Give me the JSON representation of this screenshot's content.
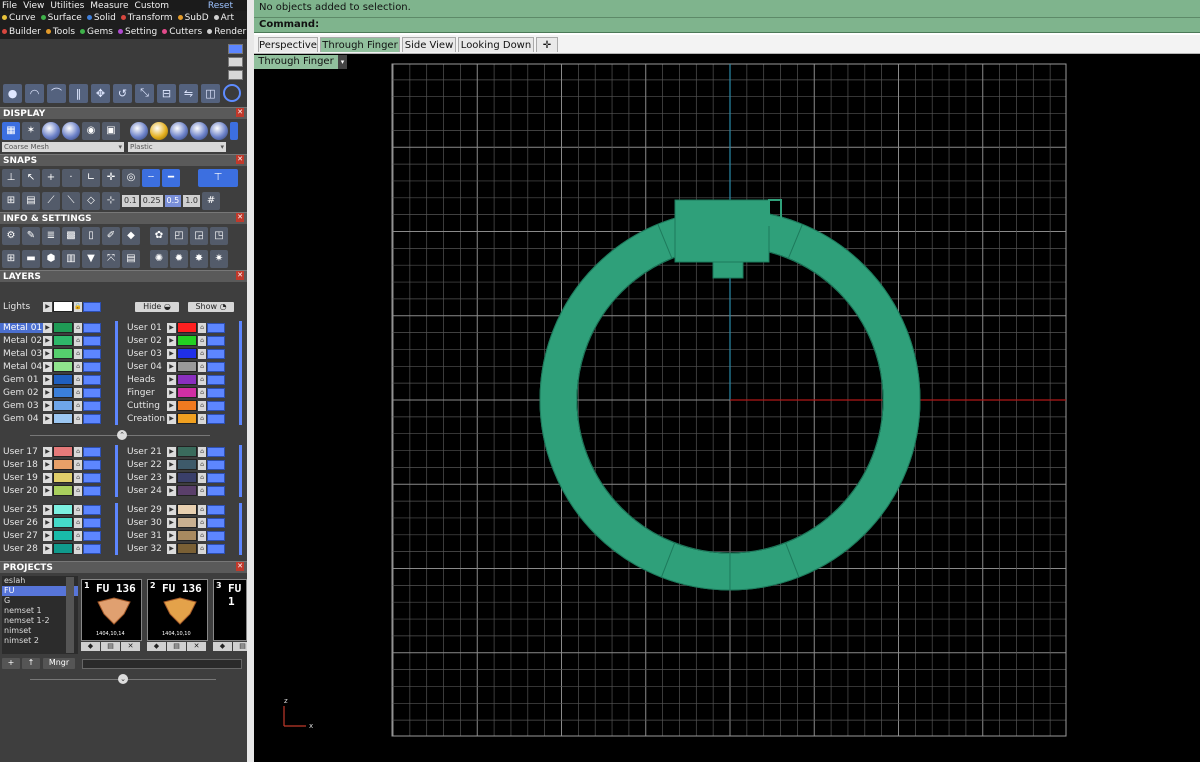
{
  "menubar": {
    "items": [
      "File",
      "View",
      "Utilities",
      "Measure",
      "Custom"
    ],
    "reset": "Reset"
  },
  "tabs1": [
    {
      "label": "Curve",
      "color": "#e8c23a"
    },
    {
      "label": "Surface",
      "color": "#3fb24a"
    },
    {
      "label": "Solid",
      "color": "#3f7ed8"
    },
    {
      "label": "Transform",
      "color": "#d8473f"
    },
    {
      "label": "SubD",
      "color": "#e29a2a"
    },
    {
      "label": "Art",
      "color": "#d0d0d0"
    }
  ],
  "tabs2": [
    {
      "label": "Builder",
      "color": "#d8473f"
    },
    {
      "label": "Tools",
      "color": "#e29a2a"
    },
    {
      "label": "Gems",
      "color": "#3fb24a"
    },
    {
      "label": "Setting",
      "color": "#b04ad0"
    },
    {
      "label": "Cutters",
      "color": "#e24a8a"
    },
    {
      "label": "Render",
      "color": "#d0d0d0"
    }
  ],
  "sections": {
    "display": "DISPLAY",
    "snaps": "SNAPS",
    "info": "INFO & SETTINGS",
    "layers": "LAYERS",
    "projects": "PROJECTS"
  },
  "display": {
    "mesh_select": "Coarse Mesh",
    "material_select": "Plastic"
  },
  "snaps": {
    "values": [
      "0.1",
      "0.25",
      "0.5",
      "1.0"
    ]
  },
  "layers": {
    "lights": "Lights",
    "hide": "Hide",
    "show": "Show",
    "groups_left": [
      [
        {
          "name": "Metal 01",
          "color": "#1f9a55"
        },
        {
          "name": "Metal 02",
          "color": "#2fb86a"
        },
        {
          "name": "Metal 03",
          "color": "#55cf6d"
        },
        {
          "name": "Metal 04",
          "color": "#8fe38d"
        }
      ],
      [
        {
          "name": "Gem 01",
          "color": "#1f5fbf"
        },
        {
          "name": "Gem 02",
          "color": "#3b7fd9"
        },
        {
          "name": "Gem 03",
          "color": "#6ea6ea"
        },
        {
          "name": "Gem 04",
          "color": "#9cc7f2"
        }
      ],
      [
        {
          "name": "User 17",
          "color": "#e57a7a"
        },
        {
          "name": "User 18",
          "color": "#e8a068"
        },
        {
          "name": "User 19",
          "color": "#e1cf6a"
        },
        {
          "name": "User 20",
          "color": "#a9cf5d"
        }
      ],
      [
        {
          "name": "User 25",
          "color": "#7cf0e1"
        },
        {
          "name": "User 26",
          "color": "#45d9c8"
        },
        {
          "name": "User 27",
          "color": "#19bba9"
        },
        {
          "name": "User 28",
          "color": "#109a8c"
        }
      ]
    ],
    "groups_right": [
      [
        {
          "name": "User 01",
          "color": "#ff2020"
        },
        {
          "name": "User 02",
          "color": "#22d022"
        },
        {
          "name": "User 03",
          "color": "#1f2fe8"
        },
        {
          "name": "User 04",
          "color": "#9a9a9a"
        }
      ],
      [
        {
          "name": "Heads",
          "color": "#8a2fbf"
        },
        {
          "name": "Finger",
          "color": "#d02fa3"
        },
        {
          "name": "Cutting",
          "color": "#f07a20"
        },
        {
          "name": "Creation",
          "color": "#f0a020"
        }
      ],
      [
        {
          "name": "User 21",
          "color": "#3a6b5c"
        },
        {
          "name": "User 22",
          "color": "#3e5a6a"
        },
        {
          "name": "User 23",
          "color": "#3a3f6a"
        },
        {
          "name": "User 24",
          "color": "#5a3f6a"
        }
      ],
      [
        {
          "name": "User 29",
          "color": "#e8d0b0"
        },
        {
          "name": "User 30",
          "color": "#c9b090"
        },
        {
          "name": "User 31",
          "color": "#a88a60"
        },
        {
          "name": "User 32",
          "color": "#7a6035"
        }
      ]
    ]
  },
  "projects": {
    "list": [
      "eslah",
      "FU",
      "G",
      "nemset 1",
      "nemset 1-2",
      "nimset",
      "nimset 2"
    ],
    "active_index": 1,
    "thumbs": [
      {
        "num": "1",
        "title": "FU 136",
        "caption": "1404,10,14"
      },
      {
        "num": "2",
        "title": "FU 136",
        "caption": "1404,10,10"
      },
      {
        "num": "3",
        "title": "FU 1",
        "caption": ""
      }
    ],
    "buttons": {
      "add": "+",
      "up": "↑",
      "mngr": "Mngr"
    }
  },
  "status": {
    "message": "No objects added to selection.",
    "command": "Command:"
  },
  "view_tabs": [
    {
      "label": "Perspective",
      "active": false
    },
    {
      "label": "Through Finger",
      "active": true
    },
    {
      "label": "Side View",
      "active": false
    },
    {
      "label": "Looking Down",
      "active": false
    },
    {
      "label": "✛",
      "active": false
    }
  ],
  "viewport": {
    "label": "Through Finger",
    "axis_z": "z",
    "axis_x": "x",
    "object_color": "#2fa07a"
  }
}
